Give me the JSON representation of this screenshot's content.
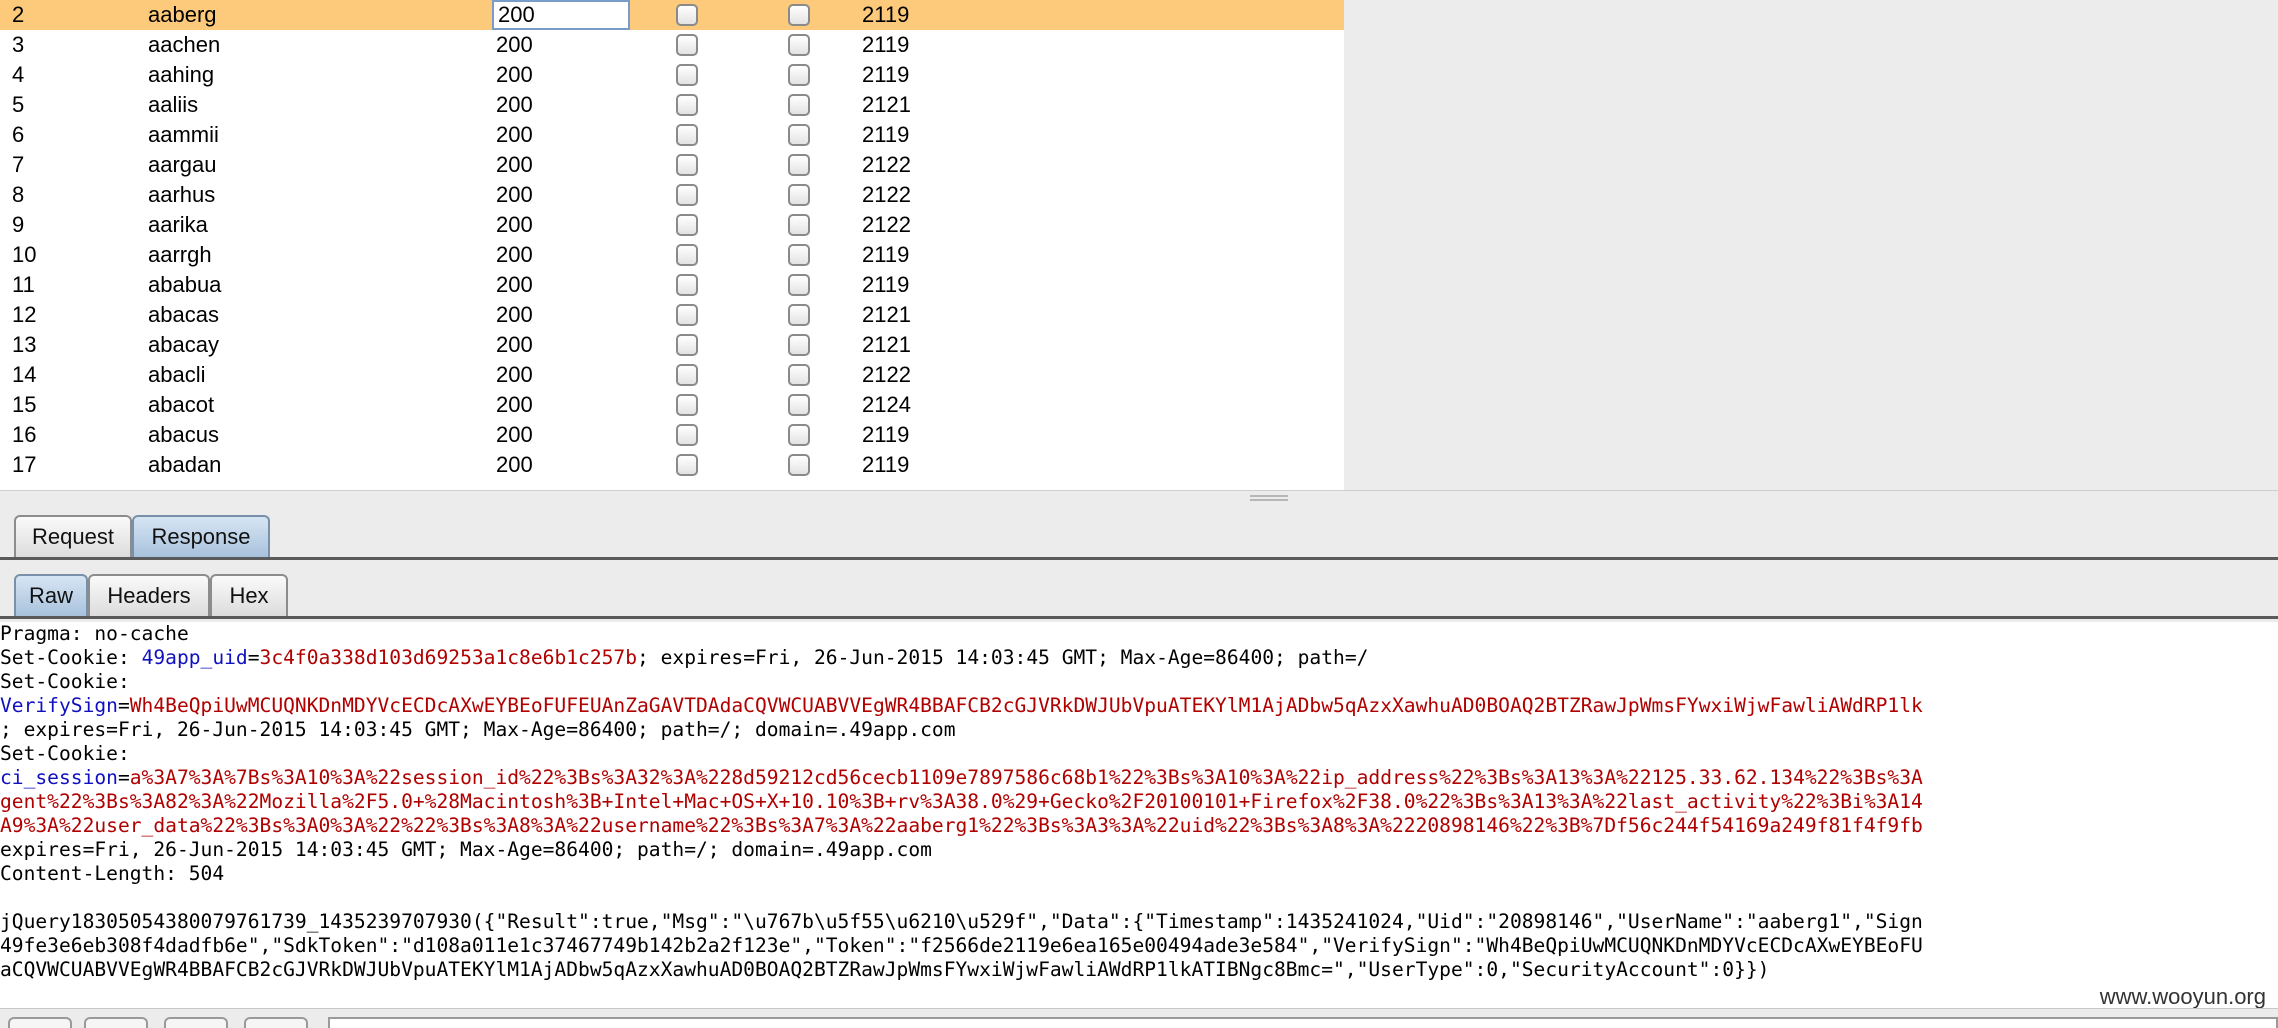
{
  "results": {
    "rows": [
      {
        "num": "2",
        "payload": "aaberg",
        "status": "200",
        "length": "2119"
      },
      {
        "num": "3",
        "payload": "aachen",
        "status": "200",
        "length": "2119"
      },
      {
        "num": "4",
        "payload": "aahing",
        "status": "200",
        "length": "2119"
      },
      {
        "num": "5",
        "payload": "aaliis",
        "status": "200",
        "length": "2121"
      },
      {
        "num": "6",
        "payload": "aammii",
        "status": "200",
        "length": "2119"
      },
      {
        "num": "7",
        "payload": "aargau",
        "status": "200",
        "length": "2122"
      },
      {
        "num": "8",
        "payload": "aarhus",
        "status": "200",
        "length": "2122"
      },
      {
        "num": "9",
        "payload": "aarika",
        "status": "200",
        "length": "2122"
      },
      {
        "num": "10",
        "payload": "aarrgh",
        "status": "200",
        "length": "2119"
      },
      {
        "num": "11",
        "payload": "ababua",
        "status": "200",
        "length": "2119"
      },
      {
        "num": "12",
        "payload": "abacas",
        "status": "200",
        "length": "2121"
      },
      {
        "num": "13",
        "payload": "abacay",
        "status": "200",
        "length": "2121"
      },
      {
        "num": "14",
        "payload": "abacli",
        "status": "200",
        "length": "2122"
      },
      {
        "num": "15",
        "payload": "abacot",
        "status": "200",
        "length": "2124"
      },
      {
        "num": "16",
        "payload": "abacus",
        "status": "200",
        "length": "2119"
      },
      {
        "num": "17",
        "payload": "abadan",
        "status": "200",
        "length": "2119"
      }
    ]
  },
  "tabs_main": {
    "request": "Request",
    "response": "Response"
  },
  "tabs_view": {
    "raw": "Raw",
    "headers": "Headers",
    "hex": "Hex"
  },
  "raw": {
    "pragma": "Pragma: no-cache",
    "sc1_label": "Set-Cookie: ",
    "sc1_key": "49app_uid",
    "sc1_val": "3c4f0a338d103d69253a1c8e6b1c257b",
    "sc1_rest": "; expires=Fri, 26-Jun-2015 14:03:45 GMT; Max-Age=86400; path=/",
    "sc2_label": "Set-Cookie: ",
    "sc2_key": "VerifySign",
    "sc2_val": "Wh4BeQpiUwMCUQNKDnMDYVcECDcAXwEYBEoFUFEUAnZaGAVTDAdaCQVWCUABVVEgWR4BBAFCB2cGJVRkDWJUbVpuATEKYlM1AjADbw5qAzxXawhuAD0BOAQ2BTZRawJpWmsFYwxiWjwFawliAWdRP1lk",
    "sc2_rest": "; expires=Fri, 26-Jun-2015 14:03:45 GMT; Max-Age=86400; path=/; domain=.49app.com",
    "sc3_label": "Set-Cookie: ",
    "sc3_key": "ci_session",
    "sc3_val1": "a%3A7%3A%7Bs%3A10%3A%22session_id%22%3Bs%3A32%3A%228d59212cd56cecb1109e7897586c68b1%22%3Bs%3A10%3A%22ip_address%22%3Bs%3A13%3A%22125.33.62.134%22%3Bs%3A",
    "sc3_val2": "gent%22%3Bs%3A82%3A%22Mozilla%2F5.0+%28Macintosh%3B+Intel+Mac+OS+X+10.10%3B+rv%3A38.0%29+Gecko%2F20100101+Firefox%2F38.0%22%3Bs%3A13%3A%22last_activity%22%3Bi%3A14",
    "sc3_val3": "A9%3A%22user_data%22%3Bs%3A0%3A%22%22%3Bs%3A8%3A%22username%22%3Bs%3A7%3A%22aaberg1%22%3Bs%3A3%3A%22uid%22%3Bs%3A8%3A%2220898146%22%3B%7Df56c244f54169a249f81f4f9fb",
    "sc3_rest": "expires=Fri, 26-Jun-2015 14:03:45 GMT; Max-Age=86400; path=/; domain=.49app.com",
    "content_length": "Content-Length: 504",
    "body1": "jQuery18305054380079761739_1435239707930({\"Result\":true,\"Msg\":\"\\u767b\\u5f55\\u6210\\u529f\",\"Data\":{\"Timestamp\":1435241024,\"Uid\":\"20898146\",\"UserName\":\"aaberg1\",\"Sign",
    "body2": "49fe3e6eb308f4dadfb6e\",\"SdkToken\":\"d108a011e1c37467749b142b2a2f123e\",\"Token\":\"f2566de2119e6ea165e00494ade3e584\",\"VerifySign\":\"Wh4BeQpiUwMCUQNKDnMDYVcECDcAXwEYBEoFU",
    "body3": "aCQVWCUABVVEgWR4BBAFCB2cGJVRkDWJUbVpuATEKYlM1AjADbw5qAzxXawhuAD0BOAQ2BTZRawJpWmsFYwxiWjwFawliAWdRP1lkATIBNgc8Bmc=\",\"UserType\":0,\"SecurityAccount\":0}})"
  },
  "watermark": "www.wooyun.org",
  "colors": {
    "selected_row": "#fdc97a",
    "cookie_name": "#1010c0",
    "cookie_value": "#b00000"
  }
}
